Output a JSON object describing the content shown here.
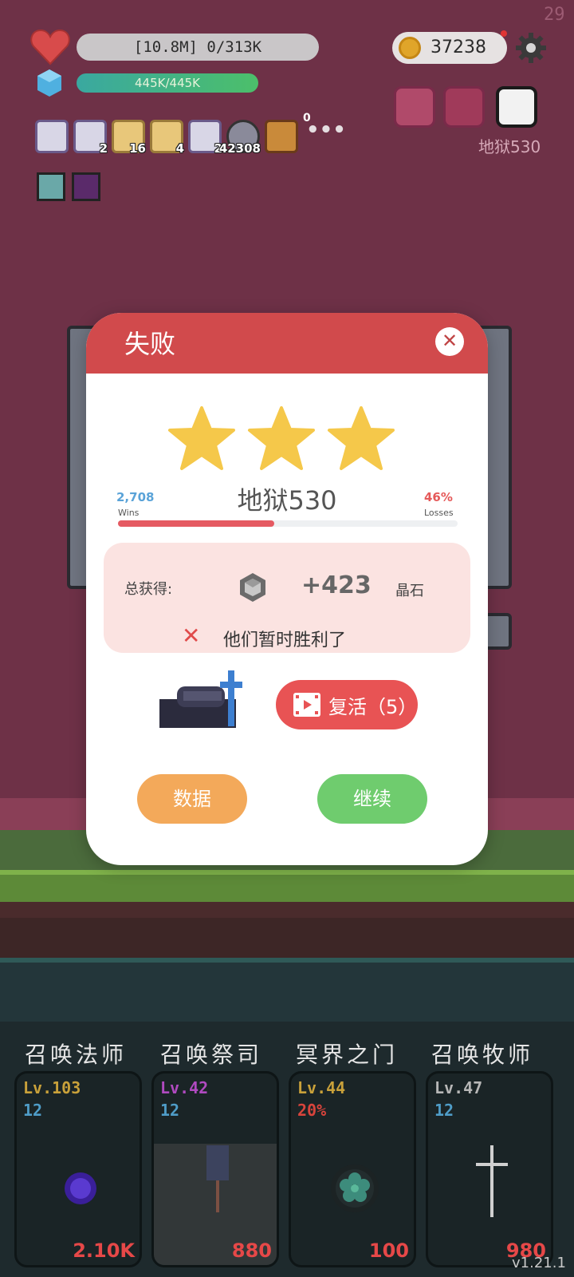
{
  "hud": {
    "fps": "29",
    "hp_text": "[10.8M] 0/313K",
    "mp_text": "445K/445K",
    "coins": "37238",
    "stage": "地狱530"
  },
  "inventory": [
    {
      "icon": "potion-card-icon",
      "count": ""
    },
    {
      "icon": "potion-card-icon",
      "count": "2"
    },
    {
      "icon": "scroll-icon",
      "count": "16"
    },
    {
      "icon": "treasure-map-icon",
      "count": "4"
    },
    {
      "icon": "potion-card-icon",
      "count": "2"
    },
    {
      "icon": "orb-icon",
      "count": "42308"
    },
    {
      "icon": "spellbook-icon",
      "count": ""
    }
  ],
  "inventory_more": {
    "count": "0",
    "dots": "•••"
  },
  "modal": {
    "title": "失败",
    "close": "✕",
    "stars": 3,
    "wins_value": "2,708",
    "wins_label": "Wins",
    "losses_value": "46%",
    "losses_label": "Losses",
    "stage_name": "地狱530",
    "win_ratio": 0.46,
    "reward_label": "总获得:",
    "reward_amount": "+423",
    "reward_unit": "晶石",
    "fail_icon": "✕",
    "fail_message": "他们暂时胜利了",
    "revive_label": "复活（5）",
    "stats_label": "数据",
    "continue_label": "继续"
  },
  "summons": [
    {
      "name": "召唤法师",
      "level": "Lv.103",
      "sub": "12",
      "cost": "2.10K",
      "level_color": "#c9a13a",
      "sub_color": "#4f9dc8",
      "dim": false
    },
    {
      "name": "召唤祭司",
      "level": "Lv.42",
      "sub": "12",
      "cost": "880",
      "level_color": "#b04ac0",
      "sub_color": "#4f9dc8",
      "dim": true
    },
    {
      "name": "冥界之门",
      "level": "Lv.44",
      "sub": "20%",
      "cost": "100",
      "level_color": "#c9a13a",
      "sub_color": "#d8443c",
      "dim": false
    },
    {
      "name": "召唤牧师",
      "level": "Lv.47",
      "sub": "12",
      "cost": "980",
      "level_color": "#b7b7b7",
      "sub_color": "#4f9dc8",
      "dim": false
    }
  ],
  "version": "v1.21.1",
  "colors": {
    "background": "#6e3147",
    "modal_header": "#d14a4c",
    "reward_bg": "#fbe3e1",
    "revive": "#e85354",
    "stats": "#f3a95a",
    "continue": "#6fcc6e",
    "star": "#f5c84a"
  }
}
